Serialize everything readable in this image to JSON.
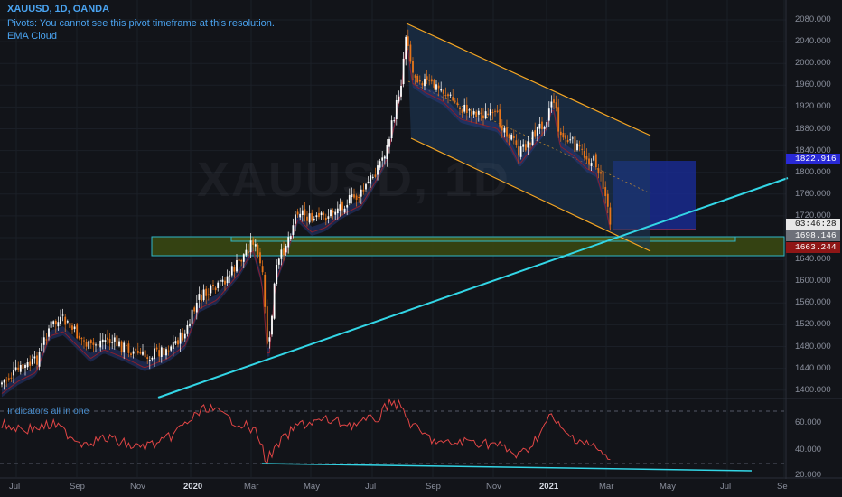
{
  "header": {
    "title": "XAUUSD, 1D, OANDA",
    "pivots_note": "Pivots: You cannot see this pivot timeframe at this resolution.",
    "ema_label": "EMA Cloud"
  },
  "watermark": "XAUUSD, 1D",
  "indicator_label": "Indicators all in one",
  "price_axis": {
    "ticks": [
      "2080.000",
      "2040.000",
      "2000.000",
      "1960.000",
      "1920.000",
      "1880.000",
      "1840.000",
      "1800.000",
      "1760.000",
      "1720.000",
      "1680.000",
      "1640.000",
      "1600.000",
      "1560.000",
      "1520.000",
      "1480.000",
      "1440.000",
      "1400.000"
    ]
  },
  "indicator_axis": {
    "ticks": [
      "60.000",
      "40.000",
      "20.000"
    ]
  },
  "price_badges": {
    "target": "1822.916",
    "countdown": "03:46:28",
    "last": "1698.146",
    "stop": "1663.244"
  },
  "time_axis": {
    "labels": [
      "Jul",
      "Sep",
      "Nov",
      "2020",
      "Mar",
      "May",
      "Jul",
      "Sep",
      "Nov",
      "2021",
      "Mar",
      "May",
      "Jul",
      "Se"
    ]
  },
  "colors": {
    "background": "#121419",
    "header_text": "#4aa3f0",
    "channel": "#f5a623",
    "trendline": "#33d6e6",
    "support_zone": "#3b4a12",
    "target_box": "#1a2c9e",
    "rsi_line": "#e04545",
    "candle_up": "#ffffff",
    "candle_down": "#e8751a"
  }
}
